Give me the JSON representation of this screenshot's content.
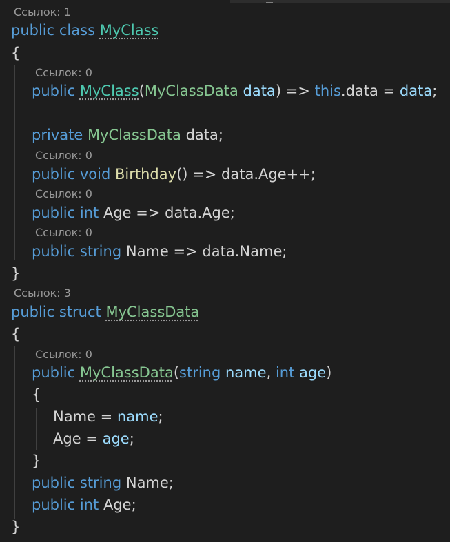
{
  "editor": {
    "codelens": {
      "class_refs": "Ссылок: 1",
      "ctor_refs": "Ссылок: 0",
      "birthday_refs": "Ссылок: 0",
      "age_refs": "Ссылок: 0",
      "name_refs": "Ссылок: 0",
      "struct_refs": "Ссылок: 3",
      "struct_ctor_refs": "Ссылок: 0"
    },
    "tokens": {
      "public": "public",
      "private": "private",
      "class": "class",
      "struct": "struct",
      "void": "void",
      "int": "int",
      "string": "string",
      "this": "this",
      "MyClass": "MyClass",
      "MyClassData": "MyClassData",
      "Birthday": "Birthday",
      "data": "data",
      "name": "name",
      "age": "age",
      "Age": "Age",
      "Name": "Name",
      "arrow": "=>",
      "eq": "=",
      "inc": "++",
      "open_brace": "{",
      "close_brace": "}",
      "paren_open": "(",
      "paren_close": ")",
      "parens": "()",
      "semicolon": ";",
      "comma": ",",
      "dot": "."
    }
  }
}
